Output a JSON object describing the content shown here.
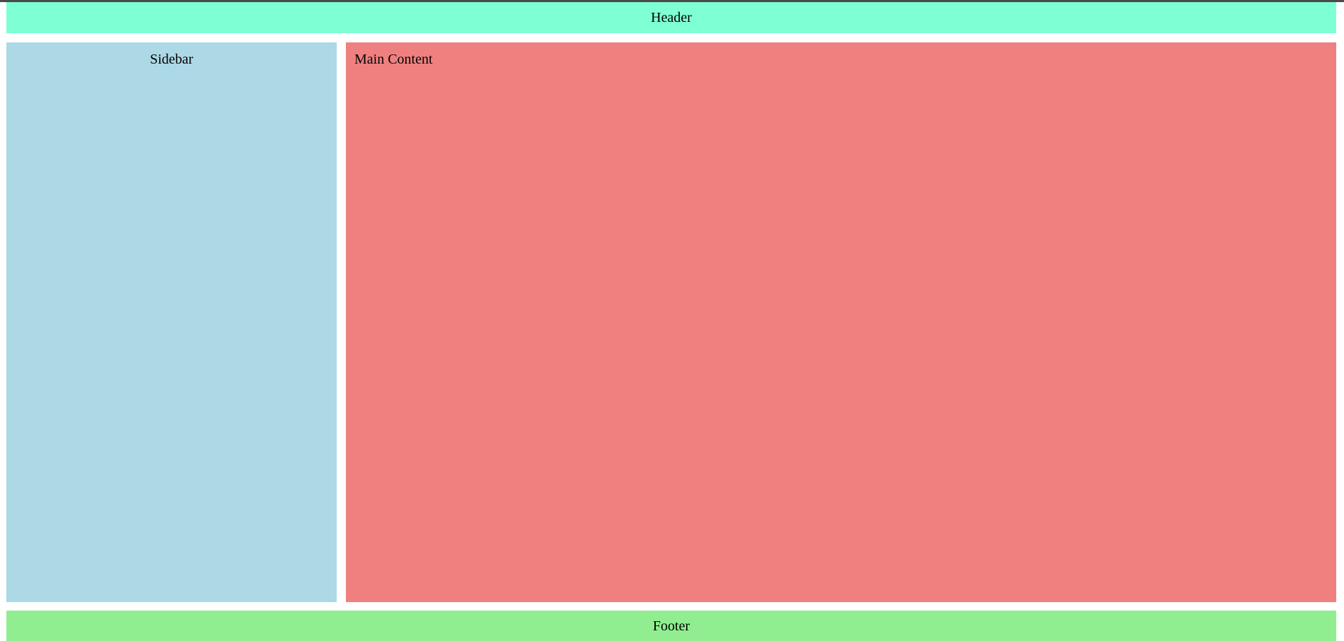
{
  "header": {
    "label": "Header",
    "color": "#7fffd4"
  },
  "sidebar": {
    "label": "Sidebar",
    "color": "#add8e6"
  },
  "main": {
    "label": "Main Content",
    "color": "#f08080"
  },
  "footer": {
    "label": "Footer",
    "color": "#90ee90"
  }
}
